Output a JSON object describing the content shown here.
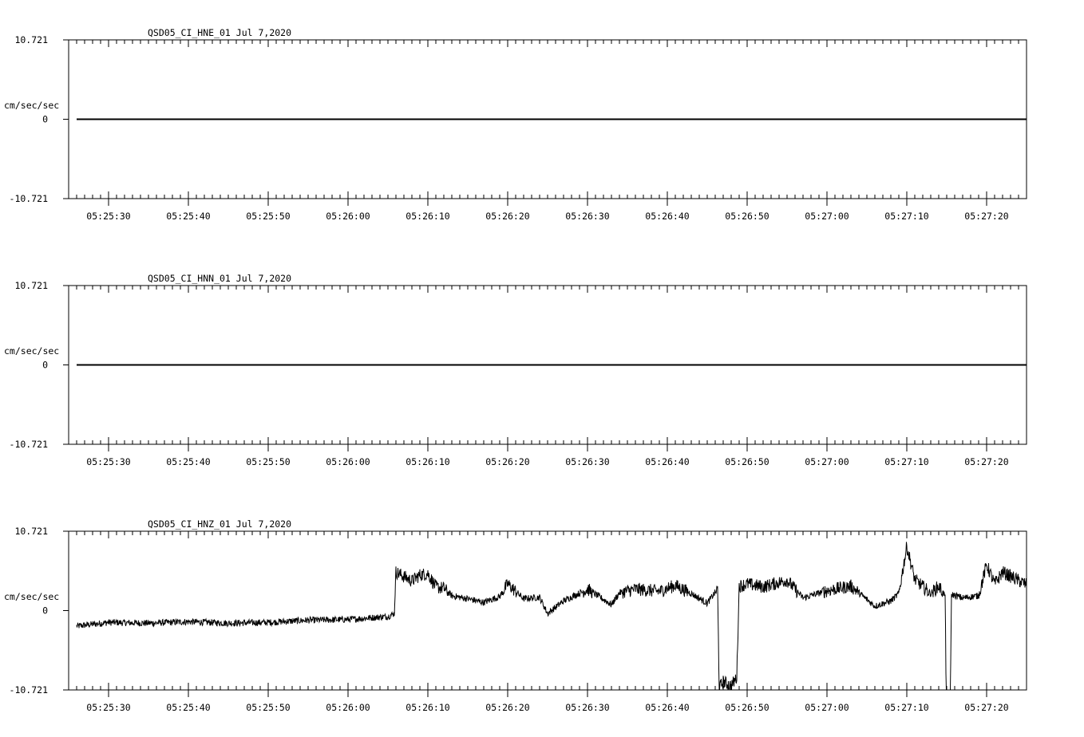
{
  "chart_data": [
    {
      "type": "line",
      "title": "QSD05_CI_HNE_01  Jul 7,2020",
      "ylabel": "cm/sec/sec",
      "ylim": [
        -10.721,
        10.721
      ],
      "y_tick_labels": [
        "10.721",
        "0",
        "-10.721"
      ],
      "xlim": [
        "05:25:25",
        "05:27:25"
      ],
      "x_tick_labels": [
        "05:25:30",
        "05:25:40",
        "05:25:50",
        "05:26:00",
        "05:26:10",
        "05:26:20",
        "05:26:30",
        "05:26:40",
        "05:26:50",
        "05:27:00",
        "05:27:10",
        "05:27:20"
      ],
      "series": [
        {
          "x": [
            "05:25:26",
            "05:27:25"
          ],
          "y": [
            0,
            0
          ]
        }
      ]
    },
    {
      "type": "line",
      "title": "QSD05_CI_HNN_01  Jul 7,2020",
      "ylabel": "cm/sec/sec",
      "ylim": [
        -10.721,
        10.721
      ],
      "y_tick_labels": [
        "10.721",
        "0",
        "-10.721"
      ],
      "xlim": [
        "05:25:25",
        "05:27:25"
      ],
      "x_tick_labels": [
        "05:25:30",
        "05:25:40",
        "05:25:50",
        "05:26:00",
        "05:26:10",
        "05:26:20",
        "05:26:30",
        "05:26:40",
        "05:26:50",
        "05:27:00",
        "05:27:10",
        "05:27:20"
      ],
      "series": [
        {
          "x": [
            "05:25:26",
            "05:27:25"
          ],
          "y": [
            0,
            0
          ]
        }
      ]
    },
    {
      "type": "line",
      "title": "QSD05_CI_HNZ_01  Jul 7,2020",
      "ylabel": "cm/sec/sec",
      "ylim": [
        -10.721,
        10.721
      ],
      "y_tick_labels": [
        "10.721",
        "0",
        "-10.721"
      ],
      "xlim": [
        "05:25:25",
        "05:27:25"
      ],
      "x_tick_labels": [
        "05:25:30",
        "05:25:40",
        "05:25:50",
        "05:26:00",
        "05:26:10",
        "05:26:20",
        "05:26:30",
        "05:26:40",
        "05:26:50",
        "05:27:00",
        "05:27:10",
        "05:27:20"
      ],
      "series": [
        {
          "x": [
            "05:25:26",
            "05:25:30",
            "05:25:35",
            "05:25:40",
            "05:25:45",
            "05:25:50",
            "05:25:55",
            "05:26:00",
            "05:26:05",
            "05:26:05.8",
            "05:26:06",
            "05:26:07",
            "05:26:08",
            "05:26:09",
            "05:26:10",
            "05:26:11",
            "05:26:12",
            "05:26:13",
            "05:26:15",
            "05:26:17",
            "05:26:19",
            "05:26:20",
            "05:26:22",
            "05:26:24",
            "05:26:25",
            "05:26:27",
            "05:26:30",
            "05:26:33",
            "05:26:34",
            "05:26:36",
            "05:26:39",
            "05:26:41",
            "05:26:43",
            "05:26:45",
            "05:26:46.3",
            "05:26:46.5",
            "05:26:47",
            "05:26:48",
            "05:26:48.7",
            "05:26:49",
            "05:26:50",
            "05:26:52",
            "05:26:55",
            "05:26:57",
            "05:27:00",
            "05:27:03",
            "05:27:06",
            "05:27:08",
            "05:27:09",
            "05:27:10",
            "05:27:11",
            "05:27:13",
            "05:27:14",
            "05:27:14.8",
            "05:27:15",
            "05:27:15.4",
            "05:27:15.6",
            "05:27:17",
            "05:27:19",
            "05:27:20",
            "05:27:21",
            "05:27:22",
            "05:27:25"
          ],
          "y": [
            -2.1,
            -1.6,
            -1.7,
            -1.5,
            -1.7,
            -1.6,
            -1.3,
            -1.2,
            -0.8,
            -0.4,
            5.2,
            4.6,
            4.0,
            4.8,
            5.0,
            3.2,
            3.0,
            2.0,
            1.6,
            1.1,
            1.9,
            3.6,
            1.6,
            1.8,
            -0.4,
            1.3,
            2.9,
            0.8,
            2.4,
            2.9,
            2.6,
            3.4,
            2.3,
            1.0,
            2.9,
            -10.5,
            -9.6,
            -10.2,
            -9.0,
            3.3,
            3.6,
            3.2,
            4.1,
            1.7,
            2.7,
            3.3,
            0.6,
            1.3,
            2.3,
            8.7,
            4.2,
            2.3,
            3.3,
            2.0,
            -17.4,
            -18.0,
            2.2,
            1.7,
            2.0,
            6.2,
            3.6,
            5.2,
            3.5
          ]
        }
      ]
    }
  ]
}
